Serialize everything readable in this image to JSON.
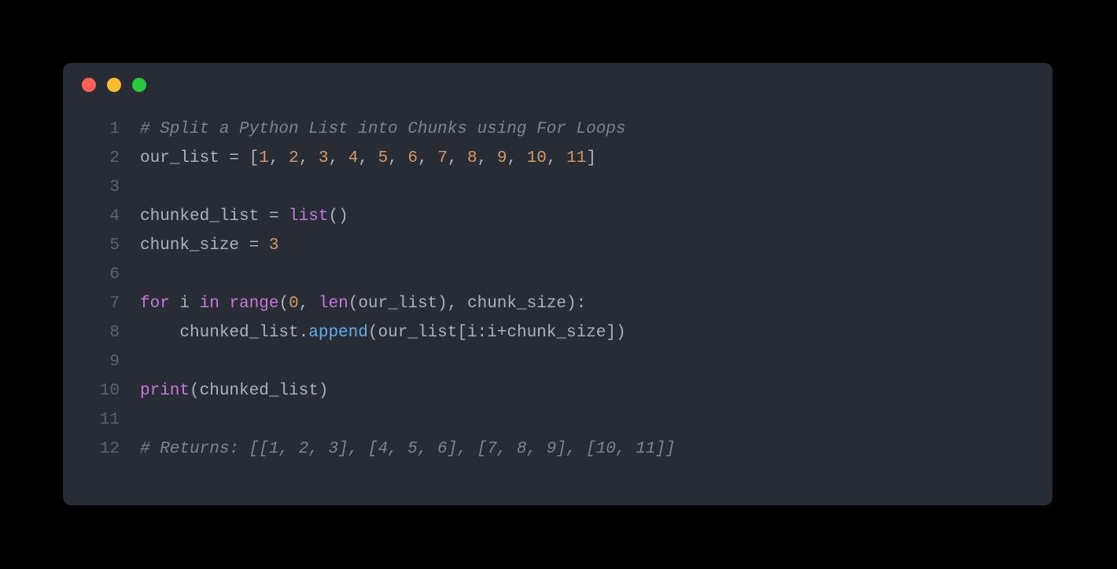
{
  "window": {
    "traffic_lights": [
      "red",
      "yellow",
      "green"
    ]
  },
  "code": {
    "language": "python",
    "lines": [
      {
        "num": "1",
        "tokens": [
          {
            "c": "tok-comment",
            "t": "# Split a Python List into Chunks using For Loops"
          }
        ]
      },
      {
        "num": "2",
        "tokens": [
          {
            "c": "tok-ident",
            "t": "our_list"
          },
          {
            "c": "tok-op",
            "t": " = "
          },
          {
            "c": "tok-bracket",
            "t": "["
          },
          {
            "c": "tok-number",
            "t": "1"
          },
          {
            "c": "tok-punct",
            "t": ", "
          },
          {
            "c": "tok-number",
            "t": "2"
          },
          {
            "c": "tok-punct",
            "t": ", "
          },
          {
            "c": "tok-number",
            "t": "3"
          },
          {
            "c": "tok-punct",
            "t": ", "
          },
          {
            "c": "tok-number",
            "t": "4"
          },
          {
            "c": "tok-punct",
            "t": ", "
          },
          {
            "c": "tok-number",
            "t": "5"
          },
          {
            "c": "tok-punct",
            "t": ", "
          },
          {
            "c": "tok-number",
            "t": "6"
          },
          {
            "c": "tok-punct",
            "t": ", "
          },
          {
            "c": "tok-number",
            "t": "7"
          },
          {
            "c": "tok-punct",
            "t": ", "
          },
          {
            "c": "tok-number",
            "t": "8"
          },
          {
            "c": "tok-punct",
            "t": ", "
          },
          {
            "c": "tok-number",
            "t": "9"
          },
          {
            "c": "tok-punct",
            "t": ", "
          },
          {
            "c": "tok-number",
            "t": "10"
          },
          {
            "c": "tok-punct",
            "t": ", "
          },
          {
            "c": "tok-number",
            "t": "11"
          },
          {
            "c": "tok-bracket",
            "t": "]"
          }
        ]
      },
      {
        "num": "3",
        "tokens": []
      },
      {
        "num": "4",
        "tokens": [
          {
            "c": "tok-ident",
            "t": "chunked_list"
          },
          {
            "c": "tok-op",
            "t": " = "
          },
          {
            "c": "tok-builtin",
            "t": "list"
          },
          {
            "c": "tok-bracket",
            "t": "()"
          }
        ]
      },
      {
        "num": "5",
        "tokens": [
          {
            "c": "tok-ident",
            "t": "chunk_size"
          },
          {
            "c": "tok-op",
            "t": " = "
          },
          {
            "c": "tok-number",
            "t": "3"
          }
        ]
      },
      {
        "num": "6",
        "tokens": []
      },
      {
        "num": "7",
        "tokens": [
          {
            "c": "tok-keyword",
            "t": "for"
          },
          {
            "c": "tok-ident",
            "t": " i "
          },
          {
            "c": "tok-keyword",
            "t": "in"
          },
          {
            "c": "tok-ident",
            "t": " "
          },
          {
            "c": "tok-builtin",
            "t": "range"
          },
          {
            "c": "tok-bracket",
            "t": "("
          },
          {
            "c": "tok-number",
            "t": "0"
          },
          {
            "c": "tok-punct",
            "t": ", "
          },
          {
            "c": "tok-builtin",
            "t": "len"
          },
          {
            "c": "tok-bracket",
            "t": "("
          },
          {
            "c": "tok-ident",
            "t": "our_list"
          },
          {
            "c": "tok-bracket",
            "t": ")"
          },
          {
            "c": "tok-punct",
            "t": ", "
          },
          {
            "c": "tok-ident",
            "t": "chunk_size"
          },
          {
            "c": "tok-bracket",
            "t": ")"
          },
          {
            "c": "tok-punct",
            "t": ":"
          }
        ]
      },
      {
        "num": "8",
        "tokens": [
          {
            "c": "tok-ident",
            "t": "    chunked_list"
          },
          {
            "c": "tok-punct",
            "t": "."
          },
          {
            "c": "tok-func",
            "t": "append"
          },
          {
            "c": "tok-bracket",
            "t": "("
          },
          {
            "c": "tok-ident",
            "t": "our_list"
          },
          {
            "c": "tok-bracket",
            "t": "["
          },
          {
            "c": "tok-ident",
            "t": "i"
          },
          {
            "c": "tok-punct",
            "t": ":"
          },
          {
            "c": "tok-ident",
            "t": "i"
          },
          {
            "c": "tok-op",
            "t": "+"
          },
          {
            "c": "tok-ident",
            "t": "chunk_size"
          },
          {
            "c": "tok-bracket",
            "t": "]"
          },
          {
            "c": "tok-bracket",
            "t": ")"
          }
        ]
      },
      {
        "num": "9",
        "tokens": []
      },
      {
        "num": "10",
        "tokens": [
          {
            "c": "tok-builtin",
            "t": "print"
          },
          {
            "c": "tok-bracket",
            "t": "("
          },
          {
            "c": "tok-ident",
            "t": "chunked_list"
          },
          {
            "c": "tok-bracket",
            "t": ")"
          }
        ]
      },
      {
        "num": "11",
        "tokens": []
      },
      {
        "num": "12",
        "tokens": [
          {
            "c": "tok-comment",
            "t": "# Returns: [[1, 2, 3], [4, 5, 6], [7, 8, 9], [10, 11]]"
          }
        ]
      }
    ]
  }
}
